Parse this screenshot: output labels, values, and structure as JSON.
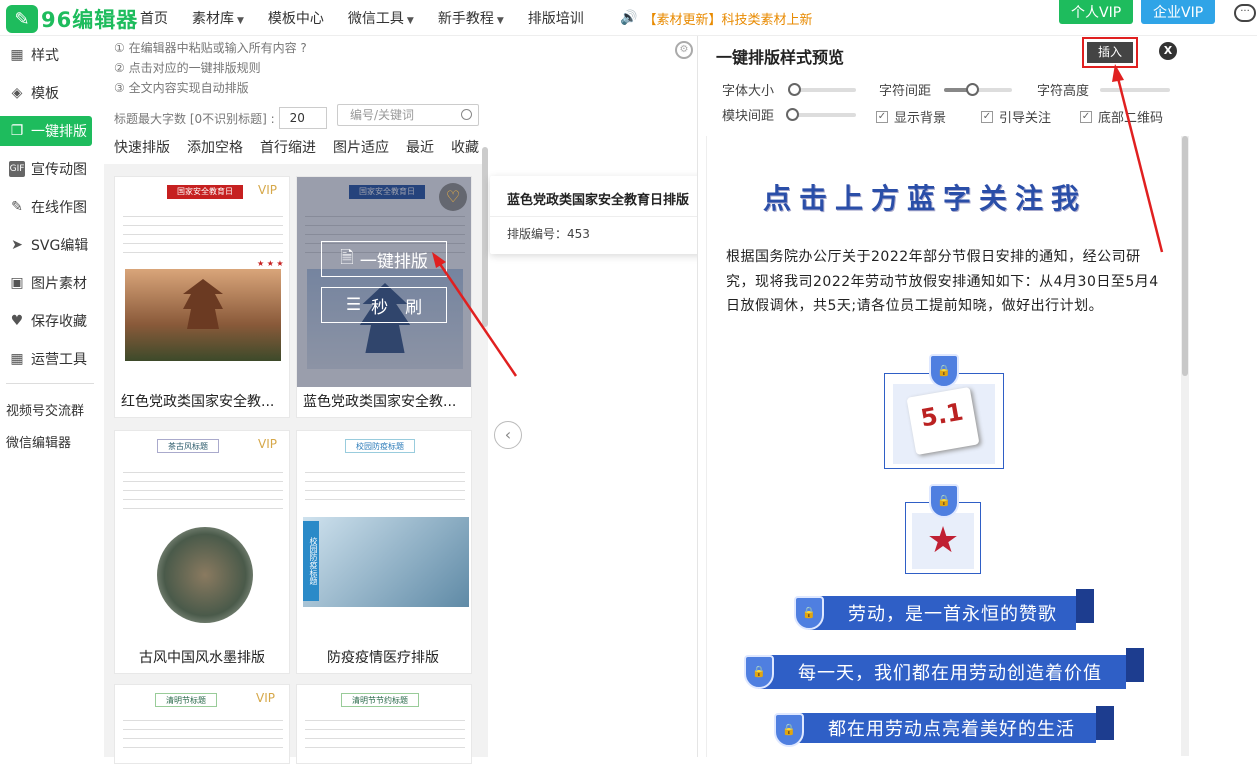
{
  "header": {
    "logo_mark": "96",
    "logo_text": "96编辑器",
    "nav": [
      {
        "label": "首页",
        "dropdown": false
      },
      {
        "label": "素材库",
        "dropdown": true
      },
      {
        "label": "模板中心",
        "dropdown": false
      },
      {
        "label": "微信工具",
        "dropdown": true
      },
      {
        "label": "新手教程",
        "dropdown": true
      },
      {
        "label": "排版培训",
        "dropdown": false
      }
    ],
    "notice": "【素材更新】科技类素材上新",
    "vip_personal": "个人VIP",
    "vip_enterprise": "企业VIP",
    "colors": {
      "brand": "#1ebc5d",
      "vip_personal": "#1ebc5d",
      "vip_enterprise": "#2fa4e7",
      "notice": "#e88a00"
    }
  },
  "sidebar": {
    "items": [
      {
        "label": "样式",
        "icon": "grid-icon",
        "glyph": "▦"
      },
      {
        "label": "模板",
        "icon": "layers-icon",
        "glyph": "◈"
      },
      {
        "label": "一键排版",
        "icon": "copy-icon",
        "glyph": "❐",
        "active": true
      },
      {
        "label": "宣传动图",
        "icon": "gif-icon",
        "glyph": "G"
      },
      {
        "label": "在线作图",
        "icon": "edit-icon",
        "glyph": "✎"
      },
      {
        "label": "SVG编辑",
        "icon": "svg-icon",
        "glyph": "➤"
      },
      {
        "label": "图片素材",
        "icon": "image-icon",
        "glyph": "▣"
      },
      {
        "label": "保存收藏",
        "icon": "heart-icon",
        "glyph": "♥"
      },
      {
        "label": "运营工具",
        "icon": "apps-icon",
        "glyph": "▦"
      }
    ],
    "links": [
      "视频号交流群",
      "微信编辑器"
    ]
  },
  "panel": {
    "steps": [
      "① 在编辑器中粘贴或输入所有内容 ?",
      "② 点击对应的一键排版规则",
      "③ 全文内容实现自动排版"
    ],
    "max_chars_label": "标题最大字数 [0不识别标题] :",
    "max_chars_value": "20",
    "search_placeholder": "编号/关键词",
    "tabs": [
      "快速排版",
      "添加空格",
      "首行缩进",
      "图片适应",
      "最近",
      "收藏"
    ],
    "overlay_buttons": [
      "一键排版",
      "秒　刷"
    ],
    "cards": [
      {
        "title": "红色党政类国家安全教...",
        "vip": "VIP",
        "ribbon": "国家安全教育日"
      },
      {
        "title": "蓝色党政类国家安全教...",
        "vip": "",
        "ribbon": "国家安全教育日"
      },
      {
        "title": "古风中国风水墨排版",
        "vip": "VIP",
        "ribbon": "茶古风标题"
      },
      {
        "title": "防疫疫情医疗排版",
        "vip": "",
        "ribbon": "校园防疫标题"
      },
      {
        "title": "",
        "vip": "VIP",
        "ribbon": "清明节标题"
      },
      {
        "title": "",
        "vip": "",
        "ribbon": "清明节节约标题"
      }
    ]
  },
  "tooltip": {
    "title": "蓝色党政类国家安全教育日排版",
    "code": "排版编号：453"
  },
  "preview": {
    "title": "一键排版样式预览",
    "insert": "插入",
    "close": "X",
    "controls": {
      "font_size": "字体大小",
      "char_spacing": "字符间距",
      "char_height": "字符高度",
      "block_spacing": "模块间距",
      "show_bg": "显示背景",
      "guide_follow": "引导关注",
      "bottom_qr": "底部二维码"
    },
    "follow_text": "点击上方蓝字关注我",
    "body": "根据国务院办公厅关于2022年部分节假日安排的通知，经公司研究，现将我司2022年劳动节放假安排通知如下：从4月30日至5月4日放假调休，共5天;请各位员工提前知晓，做好出行计划。",
    "calendar_text": "5.1",
    "banners": [
      "劳动，是一首永恒的赞歌",
      "每一天，我们都在用劳动创造着价值",
      "都在用劳动点亮着美好的生活"
    ]
  }
}
